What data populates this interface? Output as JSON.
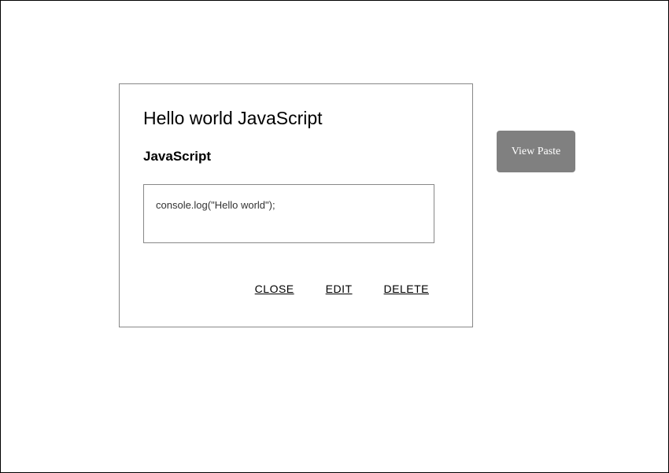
{
  "dialog": {
    "title": "Hello world JavaScript",
    "language": "JavaScript",
    "code": "console.log(\"Hello world\");",
    "actions": {
      "close": "CLOSE",
      "edit": "EDIT",
      "delete": "DELETE"
    }
  },
  "side_button": {
    "label": "View Paste"
  }
}
